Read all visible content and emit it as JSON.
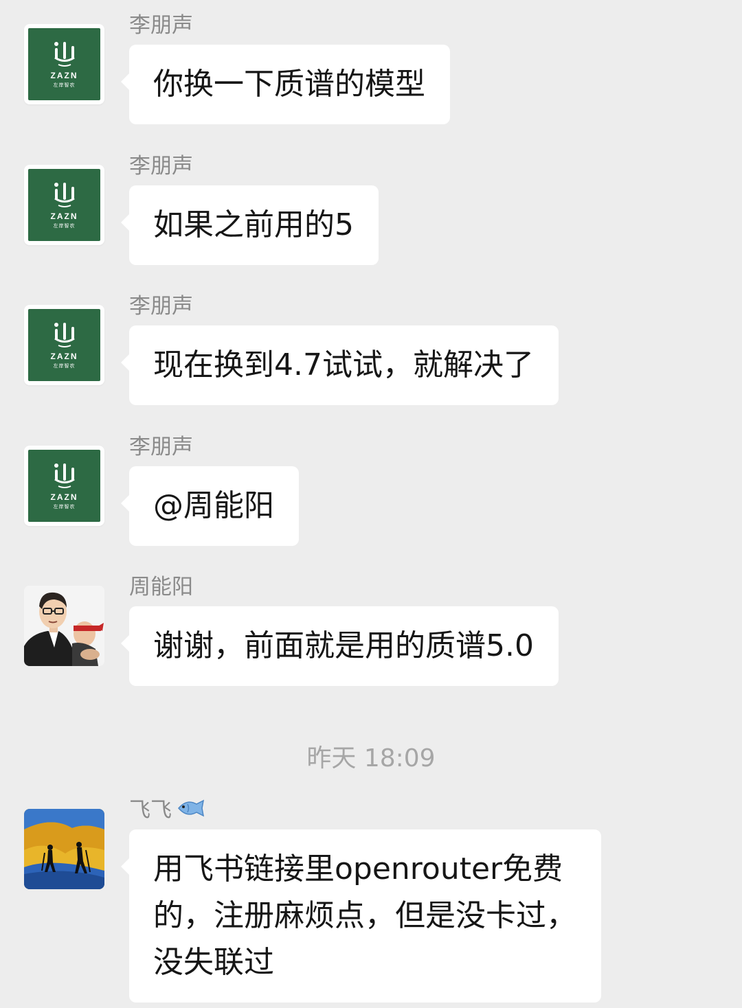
{
  "messages": [
    {
      "sender": "李朋声",
      "text": "你换一下质谱的模型",
      "avatar": "zazn-logo"
    },
    {
      "sender": "李朋声",
      "text": "如果之前用的5",
      "avatar": "zazn-logo"
    },
    {
      "sender": "李朋声",
      "text": "现在换到4.7试试，就解决了",
      "avatar": "zazn-logo"
    },
    {
      "sender": "李朋声",
      "text": "@周能阳",
      "avatar": "zazn-logo"
    },
    {
      "sender": "周能阳",
      "text": "谢谢，前面就是用的质谱5.0",
      "avatar": "cartoon-portrait"
    },
    {
      "sender": "飞飞",
      "sender_icon": "fish-emoji",
      "text": "用飞书链接里openrouter免费\n的，注册麻烦点，但是没卡过，\n没失联过",
      "avatar": "mountain-climbers"
    }
  ],
  "timestamp": "昨天 18:09",
  "logo": {
    "word": "ZAZN",
    "sub": "左岸智农"
  },
  "colors": {
    "background": "#ededed",
    "bubble": "#ffffff",
    "brand_green": "#2d6a44"
  }
}
